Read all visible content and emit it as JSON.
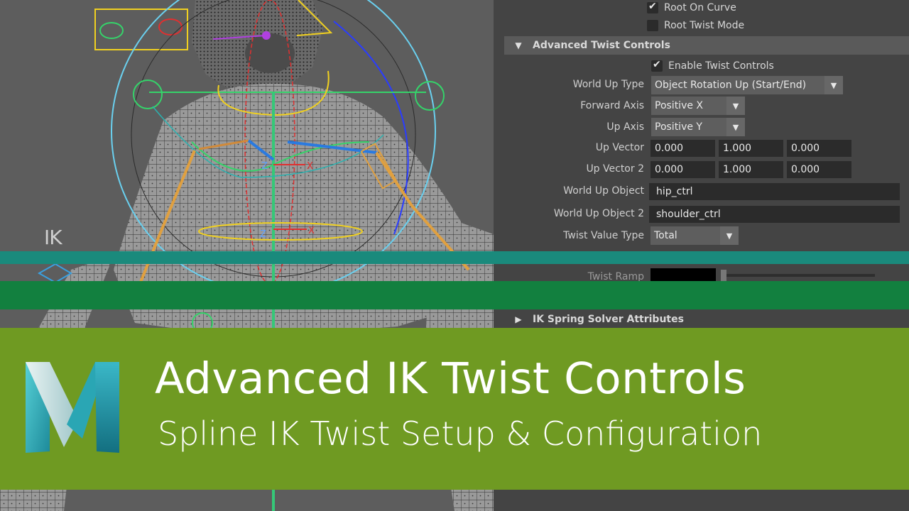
{
  "viewport": {
    "ik_label": "IK",
    "axis_labels": {
      "x": "X",
      "z": "Z"
    }
  },
  "attribute_editor": {
    "root_on_curve": {
      "label": "Root On Curve",
      "checked": true
    },
    "root_twist_mode": {
      "label": "Root Twist Mode",
      "checked": false
    },
    "advanced_twist_section": {
      "title": "Advanced Twist Controls",
      "expanded": true
    },
    "enable_twist_controls": {
      "label": "Enable Twist Controls",
      "checked": true
    },
    "world_up_type": {
      "label": "World Up Type",
      "value": "Object Rotation Up (Start/End)"
    },
    "forward_axis": {
      "label": "Forward Axis",
      "value": "Positive X"
    },
    "up_axis": {
      "label": "Up Axis",
      "value": "Positive Y"
    },
    "up_vector": {
      "label": "Up Vector",
      "values": [
        "0.000",
        "1.000",
        "0.000"
      ]
    },
    "up_vector_2": {
      "label": "Up Vector 2",
      "values": [
        "0.000",
        "1.000",
        "0.000"
      ]
    },
    "world_up_object": {
      "label": "World Up Object",
      "value": "hip_ctrl"
    },
    "world_up_object_2": {
      "label": "World Up Object 2",
      "value": "shoulder_ctrl"
    },
    "twist_value_type": {
      "label": "Twist Value Type",
      "value": "Total"
    },
    "twist_ramp": {
      "label": "Twist Ramp"
    },
    "ik_spring_section": {
      "title": "IK Spring Solver Attributes",
      "expanded": false
    }
  },
  "banner": {
    "title": "Advanced IK Twist Controls",
    "subtitle": "Spline IK Twist Setup & Configuration"
  },
  "colors": {
    "banner_green": "#6f9a22",
    "stripe_teal": "#1a8a7c",
    "stripe_green": "#12803f",
    "panel_bg": "#444444",
    "viewport_bg": "#5d5d5d"
  }
}
